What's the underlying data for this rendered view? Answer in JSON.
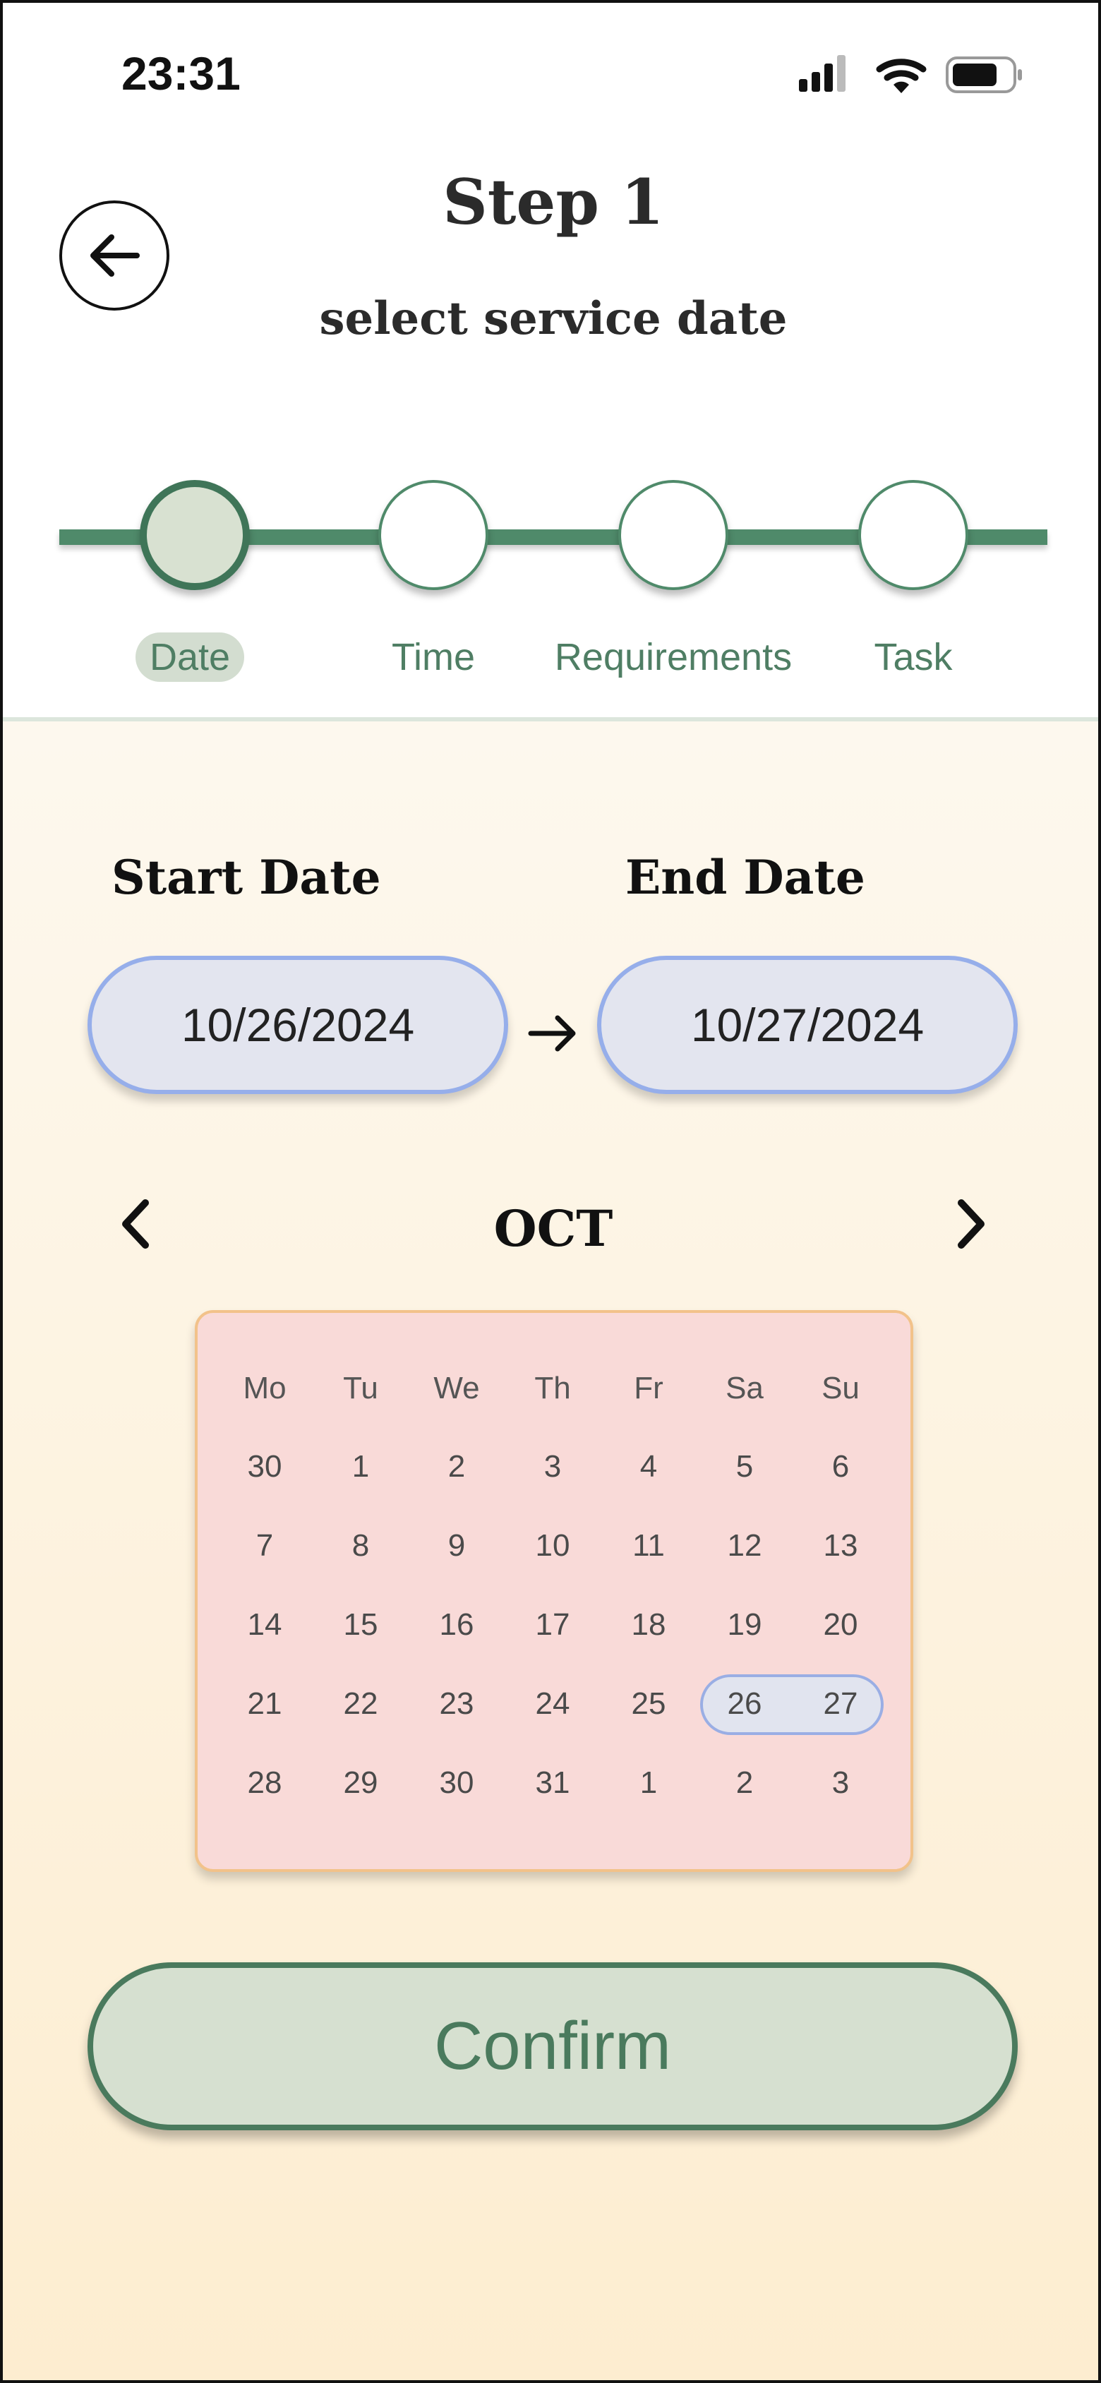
{
  "status_bar": {
    "time": "23:31",
    "icons": [
      "signal-icon",
      "wifi-icon",
      "battery-icon"
    ]
  },
  "header": {
    "title": "Step 1",
    "subtitle": "select service date",
    "back_icon": "arrow-left-icon"
  },
  "progress": {
    "steps": [
      {
        "label": "Date",
        "active": true
      },
      {
        "label": "Time",
        "active": false
      },
      {
        "label": "Requirements",
        "active": false
      },
      {
        "label": "Task",
        "active": false
      }
    ]
  },
  "dates": {
    "start_label": "Start Date",
    "start_value": "10/26/2024",
    "end_label": "End Date",
    "end_value": "10/27/2024",
    "separator_icon": "arrow-right-icon"
  },
  "calendar": {
    "month": "OCT",
    "prev_icon": "chevron-left-icon",
    "next_icon": "chevron-right-icon",
    "weekdays": [
      "Mo",
      "Tu",
      "We",
      "Th",
      "Fr",
      "Sa",
      "Su"
    ],
    "weeks": [
      [
        "30",
        "1",
        "2",
        "3",
        "4",
        "5",
        "6"
      ],
      [
        "7",
        "8",
        "9",
        "10",
        "11",
        "12",
        "13"
      ],
      [
        "14",
        "15",
        "16",
        "17",
        "18",
        "19",
        "20"
      ],
      [
        "21",
        "22",
        "23",
        "24",
        "25",
        "26",
        "27"
      ],
      [
        "28",
        "29",
        "30",
        "31",
        "1",
        "2",
        "3"
      ]
    ],
    "selected_range": [
      "26",
      "27"
    ]
  },
  "confirm_button": {
    "label": "Confirm"
  },
  "colors": {
    "accent_green": "#4f8a6a",
    "pill_blue_border": "#96aeea",
    "calendar_bg": "#f9dad8",
    "background_bottom": "#fdedd0"
  }
}
